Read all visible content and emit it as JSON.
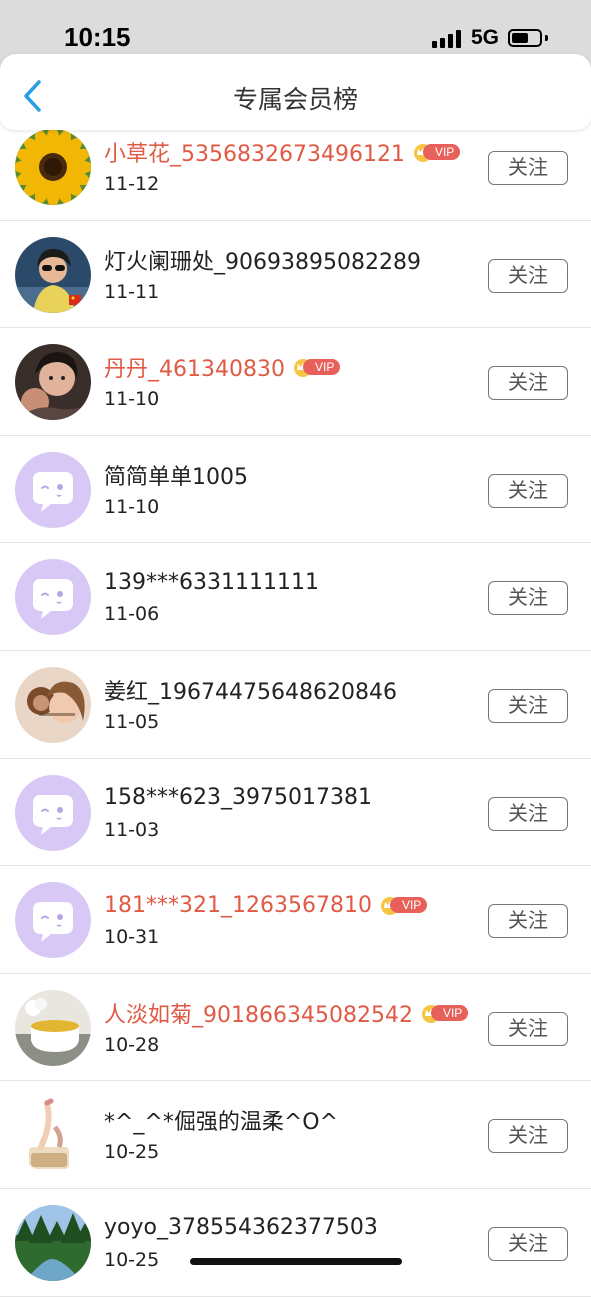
{
  "status_bar": {
    "time": "10:15",
    "network": "5G"
  },
  "header": {
    "title": "专属会员榜"
  },
  "colors": {
    "vip_name": "#e05a45",
    "default_avatar_bg": "#d8c8f5",
    "default_avatar_bubble": "#ffffff"
  },
  "badge": {
    "vip_label": "VIP"
  },
  "members": [
    {
      "name": "小草花_5356832673496121",
      "date": "11-12",
      "vip": true,
      "avatar": "sunflower",
      "follow": "关注"
    },
    {
      "name": "灯火阑珊处_90693895082289",
      "date": "11-11",
      "vip": false,
      "avatar": "woman-sunglasses",
      "follow": "关注"
    },
    {
      "name": "丹丹_461340830",
      "date": "11-10",
      "vip": true,
      "avatar": "selfie",
      "follow": "关注"
    },
    {
      "name": "简简单单1005",
      "date": "11-10",
      "vip": false,
      "avatar": "default-chat",
      "follow": "关注"
    },
    {
      "name": "139***6331111111",
      "date": "11-06",
      "vip": false,
      "avatar": "default-chat",
      "follow": "关注"
    },
    {
      "name": "姜红_19674475648620846",
      "date": "11-05",
      "vip": false,
      "avatar": "portrait-monkey",
      "follow": "关注"
    },
    {
      "name": "158***623_3975017381",
      "date": "11-03",
      "vip": false,
      "avatar": "default-chat",
      "follow": "关注"
    },
    {
      "name": "181***321_1263567810",
      "date": "10-31",
      "vip": true,
      "avatar": "default-chat",
      "follow": "关注"
    },
    {
      "name": "人淡如菊_901866345082542",
      "date": "10-28",
      "vip": true,
      "avatar": "tea-cup",
      "follow": "关注"
    },
    {
      "name": "*^_^*倔强的温柔^O^",
      "date": "10-25",
      "vip": false,
      "avatar": "yoga",
      "follow": "关注"
    },
    {
      "name": "yoyo_378554362377503",
      "date": "10-25",
      "vip": false,
      "avatar": "forest",
      "follow": "关注"
    }
  ]
}
